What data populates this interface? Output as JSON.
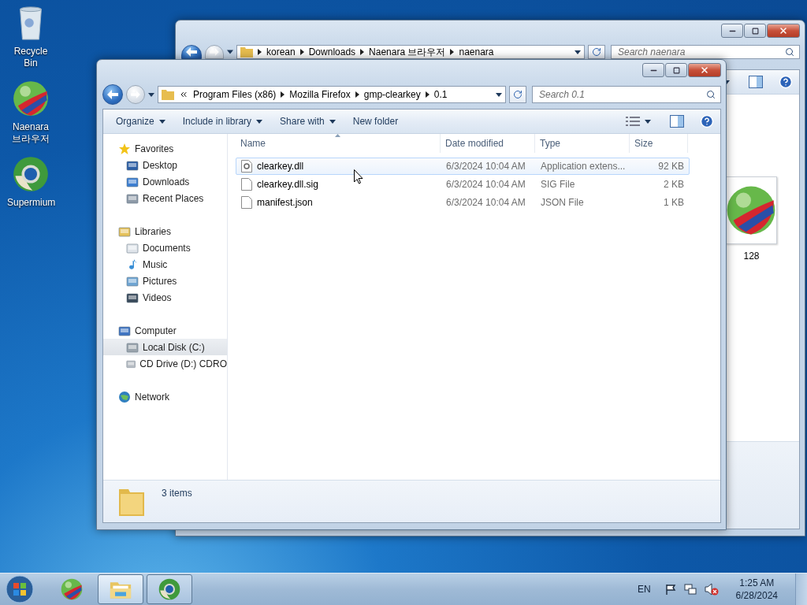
{
  "desktop_icons": [
    {
      "label": "Recycle Bin",
      "kind": "recycle"
    },
    {
      "label": "Naenara 브라우저",
      "kind": "naenara"
    },
    {
      "label": "Supermium",
      "kind": "supermium"
    }
  ],
  "back_window": {
    "breadcrumb": [
      "korean",
      "Downloads",
      "Naenara 브라우저",
      "naenara"
    ],
    "search": {
      "placeholder": "Search naenara"
    },
    "items": [
      {
        "label": "128",
        "kind": "naenara"
      }
    ]
  },
  "front_window": {
    "breadcrumb": [
      "Program Files (x86)",
      "Mozilla Firefox",
      "gmp-clearkey",
      "0.1"
    ],
    "search": {
      "placeholder": "Search 0.1"
    },
    "toolbar": [
      {
        "label": "Organize",
        "dropdown": true
      },
      {
        "label": "Include in library",
        "dropdown": true
      },
      {
        "label": "Share with",
        "dropdown": true
      },
      {
        "label": "New folder",
        "dropdown": false
      }
    ],
    "nav": [
      {
        "label": "Favorites",
        "kind": "star",
        "selected": false,
        "children": [
          {
            "label": "Desktop",
            "kind": "desktop",
            "selected": false
          },
          {
            "label": "Downloads",
            "kind": "downloads",
            "selected": false
          },
          {
            "label": "Recent Places",
            "kind": "recent",
            "selected": false
          }
        ]
      },
      {
        "label": "Libraries",
        "kind": "library",
        "selected": false,
        "children": [
          {
            "label": "Documents",
            "kind": "documents",
            "selected": false
          },
          {
            "label": "Music",
            "kind": "music",
            "selected": false
          },
          {
            "label": "Pictures",
            "kind": "pictures",
            "selected": false
          },
          {
            "label": "Videos",
            "kind": "videos",
            "selected": false
          }
        ]
      },
      {
        "label": "Computer",
        "kind": "computer",
        "selected": false,
        "children": [
          {
            "label": "Local Disk (C:)",
            "kind": "disk",
            "selected": true
          },
          {
            "label": "CD Drive (D:) CDRO",
            "kind": "cd",
            "selected": false
          }
        ]
      },
      {
        "label": "Network",
        "kind": "network",
        "selected": false
      }
    ],
    "columns": [
      "Name",
      "Date modified",
      "Type",
      "Size"
    ],
    "rows": [
      {
        "name": "clearkey.dll",
        "date": "6/3/2024 10:04 AM",
        "type": "Application extens...",
        "size": "92 KB",
        "kind": "dll",
        "hovered": true
      },
      {
        "name": "clearkey.dll.sig",
        "date": "6/3/2024 10:04 AM",
        "type": "SIG File",
        "size": "2 KB",
        "kind": "file",
        "hovered": false
      },
      {
        "name": "manifest.json",
        "date": "6/3/2024 10:04 AM",
        "type": "JSON File",
        "size": "1 KB",
        "kind": "file",
        "hovered": false
      }
    ],
    "status": "3 items"
  },
  "taskbar": {
    "items": [
      {
        "kind": "naenara",
        "running": false,
        "active": false
      },
      {
        "kind": "explorer",
        "running": true,
        "active": true
      },
      {
        "kind": "supermium",
        "running": true,
        "active": false
      }
    ],
    "language": "EN",
    "time": "1:25 AM",
    "date": "6/28/2024"
  }
}
